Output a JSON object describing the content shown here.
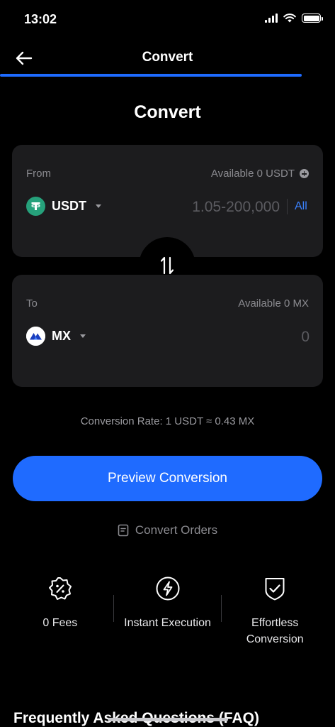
{
  "status_bar": {
    "time": "13:02"
  },
  "header": {
    "title": "Convert"
  },
  "page": {
    "title": "Convert"
  },
  "from_card": {
    "label": "From",
    "available": "Available 0 USDT",
    "coin": "USDT",
    "amount_placeholder": "1.05-200,000",
    "all_label": "All"
  },
  "to_card": {
    "label": "To",
    "available": "Available 0 MX",
    "coin": "MX",
    "amount_placeholder": "0"
  },
  "conversion_rate": "Conversion Rate: 1 USDT ≈ 0.43 MX",
  "preview_button": "Preview Conversion",
  "convert_orders": "Convert Orders",
  "features": [
    {
      "icon": "percent-badge-icon",
      "label": "0 Fees"
    },
    {
      "icon": "lightning-icon",
      "label": "Instant Execution"
    },
    {
      "icon": "shield-check-icon",
      "label": "Effortless Conversion"
    }
  ],
  "faq_title": "Frequently Asked Questions (FAQ)",
  "colors": {
    "accent": "#1f6bff",
    "card": "#1c1c1e",
    "usdt": "#26a17b"
  }
}
